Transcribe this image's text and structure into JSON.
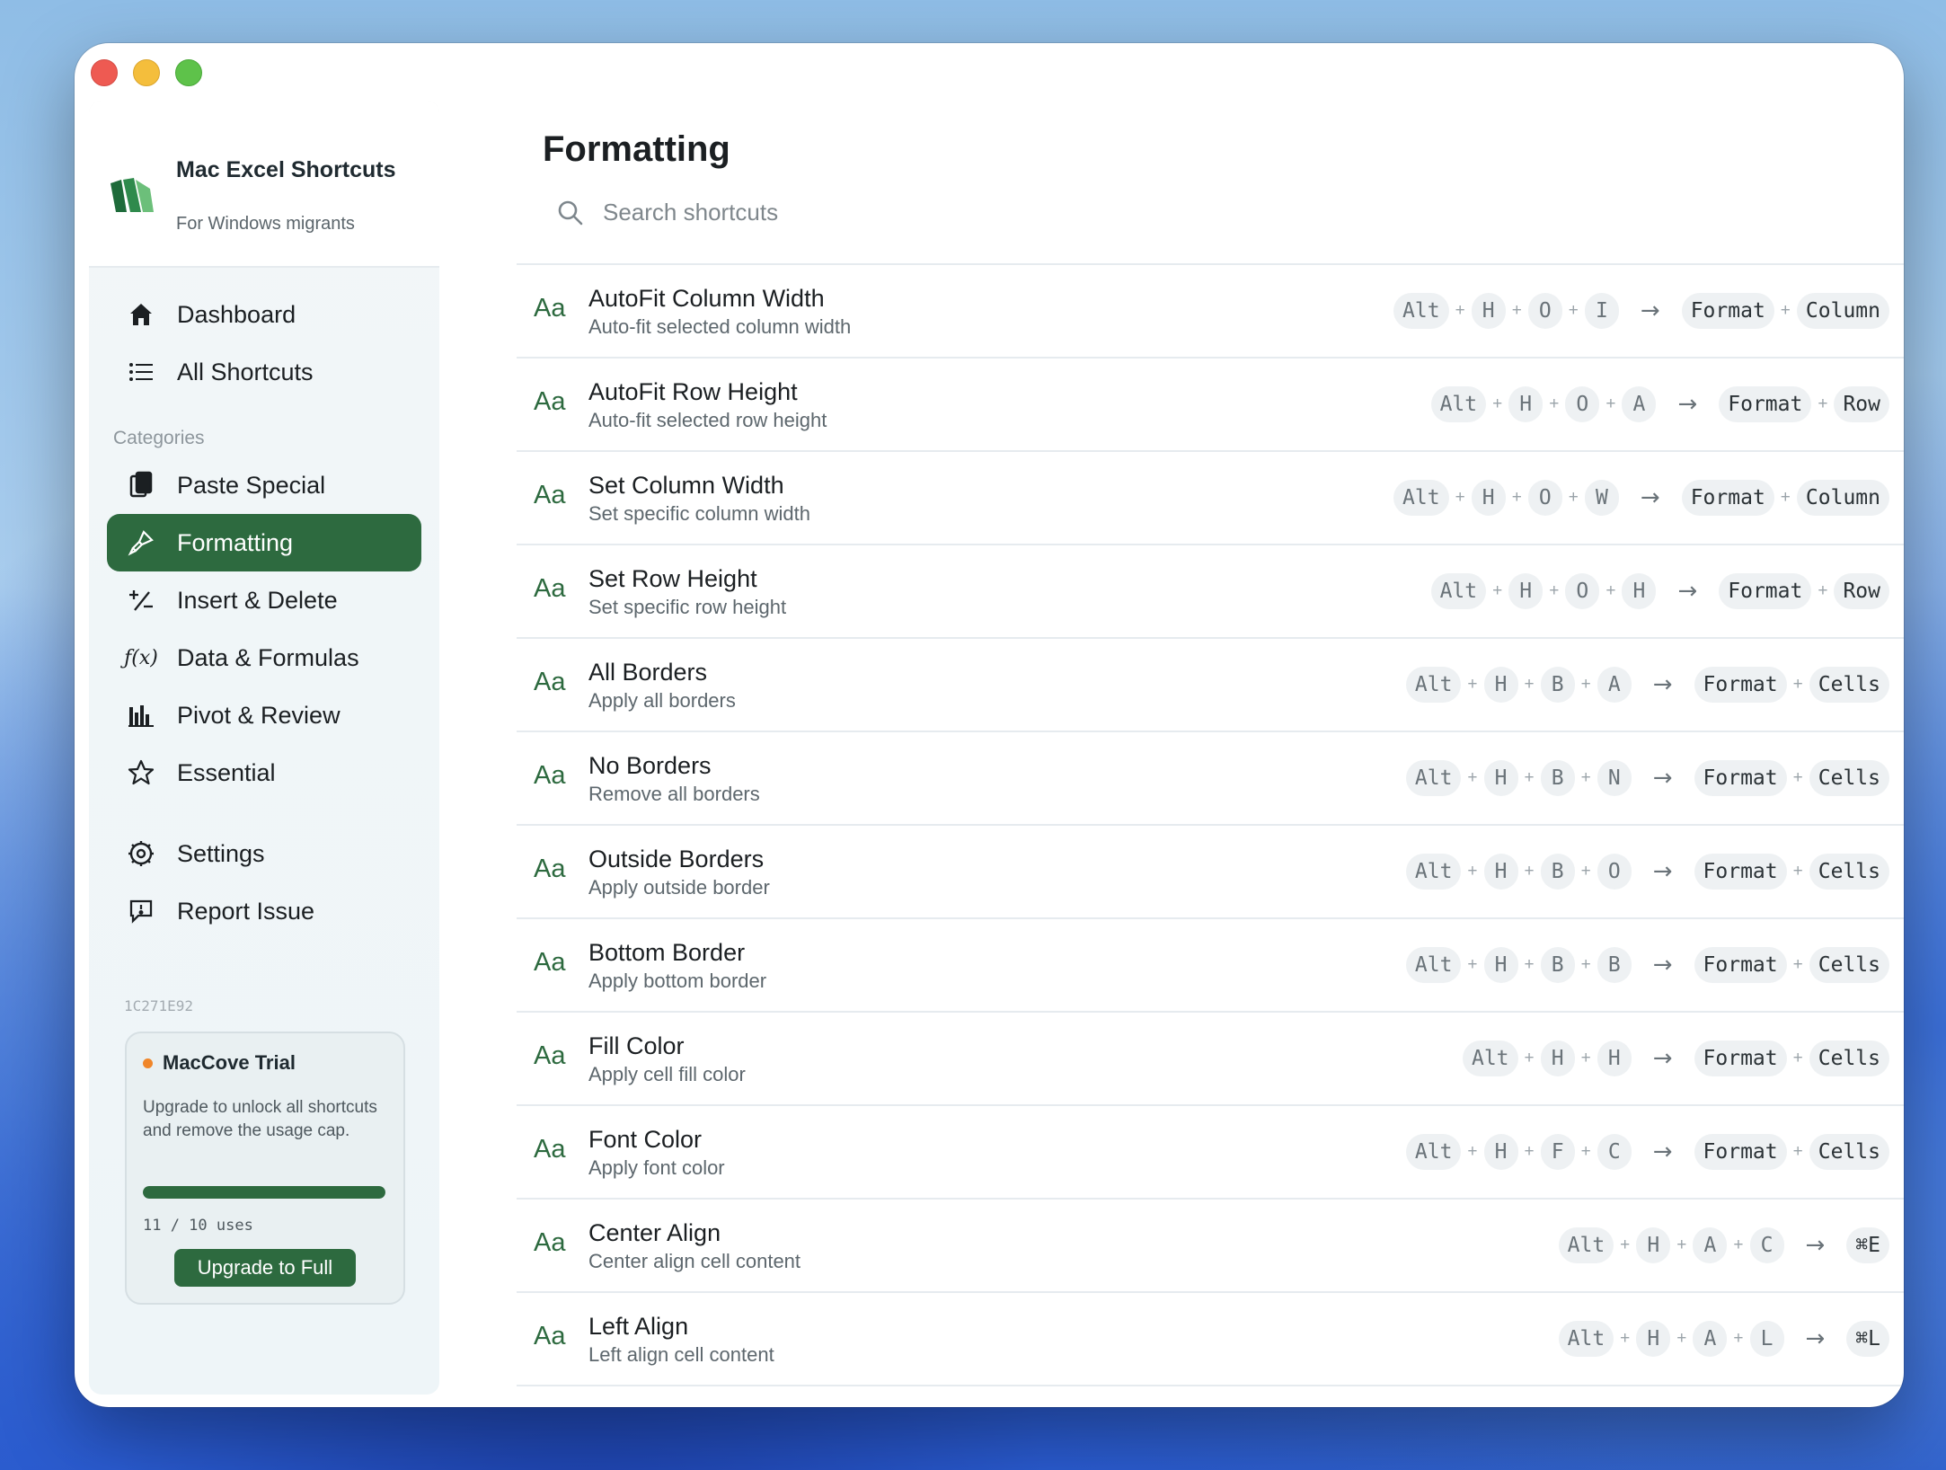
{
  "sidebar": {
    "brand_title": "Mac Excel Shortcuts",
    "brand_subtitle": "For Windows migrants",
    "nav": [
      {
        "label": "Dashboard",
        "icon": "house-icon"
      },
      {
        "label": "All Shortcuts",
        "icon": "list-icon"
      }
    ],
    "categories_label": "Categories",
    "categories": [
      {
        "label": "Paste Special",
        "icon": "clipboard-icon"
      },
      {
        "label": "Formatting",
        "icon": "brush-icon",
        "active": true
      },
      {
        "label": "Insert & Delete",
        "icon": "plus-minus-icon"
      },
      {
        "label": "Data & Formulas",
        "icon": "function-icon"
      },
      {
        "label": "Pivot & Review",
        "icon": "bar-chart-icon"
      },
      {
        "label": "Essential",
        "icon": "star-icon"
      }
    ],
    "footer_nav": [
      {
        "label": "Settings",
        "icon": "gear-icon"
      },
      {
        "label": "Report Issue",
        "icon": "report-bubble-icon"
      }
    ],
    "device_id": "1C271E92",
    "trial": {
      "title": "MacCove Trial",
      "text": "Upgrade to unlock all shortcuts and remove the usage cap.",
      "usage": "11 / 10 uses",
      "progress": 1.0,
      "button": "Upgrade to Full"
    }
  },
  "main": {
    "title": "Formatting",
    "search_placeholder": "Search shortcuts",
    "shortcuts": [
      {
        "name": "AutoFit Column Width",
        "desc": "Auto-fit selected column width",
        "win": [
          "Alt",
          "H",
          "O",
          "I"
        ],
        "mac": [
          "Format",
          "Column"
        ]
      },
      {
        "name": "AutoFit Row Height",
        "desc": "Auto-fit selected row height",
        "win": [
          "Alt",
          "H",
          "O",
          "A"
        ],
        "mac": [
          "Format",
          "Row"
        ]
      },
      {
        "name": "Set Column Width",
        "desc": "Set specific column width",
        "win": [
          "Alt",
          "H",
          "O",
          "W"
        ],
        "mac": [
          "Format",
          "Column"
        ]
      },
      {
        "name": "Set Row Height",
        "desc": "Set specific row height",
        "win": [
          "Alt",
          "H",
          "O",
          "H"
        ],
        "mac": [
          "Format",
          "Row"
        ]
      },
      {
        "name": "All Borders",
        "desc": "Apply all borders",
        "win": [
          "Alt",
          "H",
          "B",
          "A"
        ],
        "mac": [
          "Format",
          "Cells"
        ]
      },
      {
        "name": "No Borders",
        "desc": "Remove all borders",
        "win": [
          "Alt",
          "H",
          "B",
          "N"
        ],
        "mac": [
          "Format",
          "Cells"
        ]
      },
      {
        "name": "Outside Borders",
        "desc": "Apply outside border",
        "win": [
          "Alt",
          "H",
          "B",
          "O"
        ],
        "mac": [
          "Format",
          "Cells"
        ]
      },
      {
        "name": "Bottom Border",
        "desc": "Apply bottom border",
        "win": [
          "Alt",
          "H",
          "B",
          "B"
        ],
        "mac": [
          "Format",
          "Cells"
        ]
      },
      {
        "name": "Fill Color",
        "desc": "Apply cell fill color",
        "win": [
          "Alt",
          "H",
          "H"
        ],
        "mac": [
          "Format",
          "Cells"
        ]
      },
      {
        "name": "Font Color",
        "desc": "Apply font color",
        "win": [
          "Alt",
          "H",
          "F",
          "C"
        ],
        "mac": [
          "Format",
          "Cells"
        ]
      },
      {
        "name": "Center Align",
        "desc": "Center align cell content",
        "win": [
          "Alt",
          "H",
          "A",
          "C"
        ],
        "mac": [
          "⌘E"
        ]
      },
      {
        "name": "Left Align",
        "desc": "Left align cell content",
        "win": [
          "Alt",
          "H",
          "A",
          "L"
        ],
        "mac": [
          "⌘L"
        ]
      }
    ],
    "font_glyph": "Aa",
    "arrow_glyph": "→",
    "plus_glyph": "+"
  },
  "colors": {
    "accent": "#2d6a3f",
    "trial_dot": "#f0862a"
  }
}
